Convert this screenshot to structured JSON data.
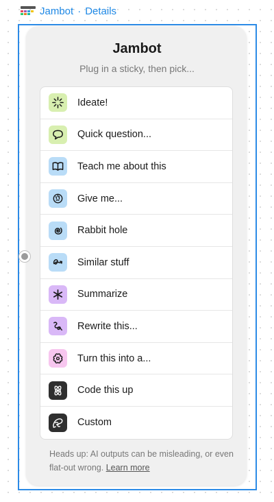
{
  "header": {
    "app_name": "Jambot",
    "separator": "·",
    "details_link": "Details"
  },
  "widget": {
    "title": "Jambot",
    "subtitle": "Plug in a sticky, then pick...",
    "items": [
      {
        "label": "Ideate!",
        "icon": "sparkle-burst-icon",
        "color": "#d8efb0"
      },
      {
        "label": "Quick question...",
        "icon": "speech-bubble-icon",
        "color": "#d8efb0"
      },
      {
        "label": "Teach me about this",
        "icon": "open-book-icon",
        "color": "#b9dcf7"
      },
      {
        "label": "Give me...",
        "icon": "brain-icon",
        "color": "#b9dcf7"
      },
      {
        "label": "Rabbit hole",
        "icon": "spiral-icon",
        "color": "#b9dcf7"
      },
      {
        "label": "Similar stuff",
        "icon": "loop-arrow-icon",
        "color": "#b9dcf7"
      },
      {
        "label": "Summarize",
        "icon": "asterisk-icon",
        "color": "#d9b8f7"
      },
      {
        "label": "Rewrite this...",
        "icon": "squiggle-icon",
        "color": "#d9b8f7"
      },
      {
        "label": "Turn this into a...",
        "icon": "flower-icon",
        "color": "#f7c6ef"
      },
      {
        "label": "Code this up",
        "icon": "atom-icon",
        "color": "#2f2f2f"
      },
      {
        "label": "Custom",
        "icon": "custom-scribble-icon",
        "color": "#2f2f2f"
      }
    ],
    "footer_text": "Heads up: AI outputs can be misleading, or even flat-out wrong.",
    "footer_link": "Learn more"
  }
}
